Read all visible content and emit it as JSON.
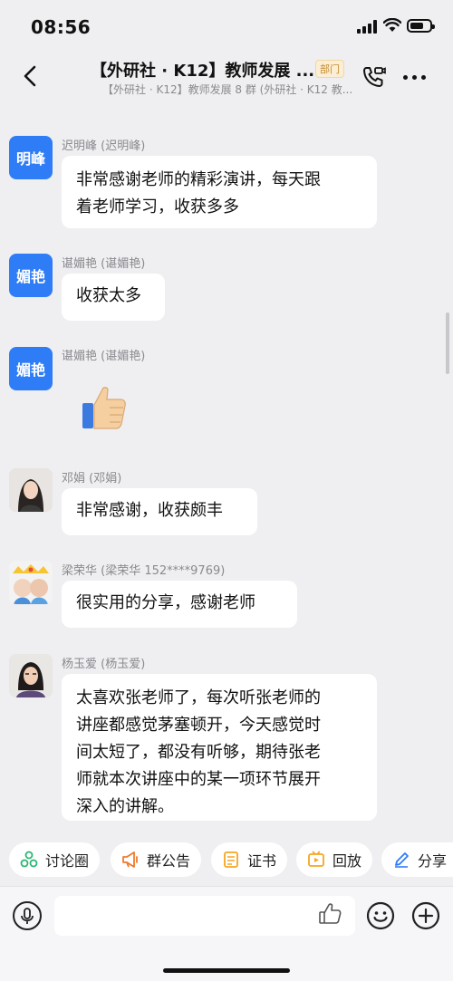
{
  "status_bar": {
    "time": "08:56"
  },
  "header": {
    "title": "【外研社 · K12】教师发展 ...",
    "badge": "部门",
    "subtitle": "【外研社 · K12】教师发展 8 群 (外研社 · K12 教..."
  },
  "messages": [
    {
      "avatar_text": "明峰",
      "sender": "迟明峰 (迟明峰)",
      "text": [
        "非常感谢老师的精彩演讲，每天跟",
        "着老师学习，收获多多"
      ]
    },
    {
      "avatar_text": "媚艳",
      "sender": "谌媚艳 (谌媚艳)",
      "text": [
        "收获太多"
      ]
    },
    {
      "avatar_text": "媚艳",
      "sender": "谌媚艳 (谌媚艳)",
      "sticker": "thumbs-up"
    },
    {
      "sender": "邓娟 (邓娟)",
      "text": [
        "非常感谢，收获颇丰"
      ]
    },
    {
      "sender": "梁荣华 (梁荣华 152****9769)",
      "text": [
        "很实用的分享，感谢老师"
      ]
    },
    {
      "sender": "杨玉爱 (杨玉爱)",
      "text": [
        "太喜欢张老师了，每次听张老师的",
        "讲座都感觉茅塞顿开，今天感觉时",
        "间太短了，都没有听够，期待张老",
        "师就本次讲座中的某一项环节展开",
        "深入的讲解。"
      ]
    }
  ],
  "quick_actions": [
    {
      "label": "讨论圈",
      "icon": "discussion-icon",
      "color": "#2bb673"
    },
    {
      "label": "群公告",
      "icon": "megaphone-icon",
      "color": "#f07a2b"
    },
    {
      "label": "证书",
      "icon": "certificate-icon",
      "color": "#f5a623"
    },
    {
      "label": "回放",
      "icon": "playback-icon",
      "color": "#f5a623"
    },
    {
      "label": "分享",
      "icon": "share-icon",
      "color": "#2f7df6"
    }
  ],
  "input": {
    "placeholder": ""
  }
}
